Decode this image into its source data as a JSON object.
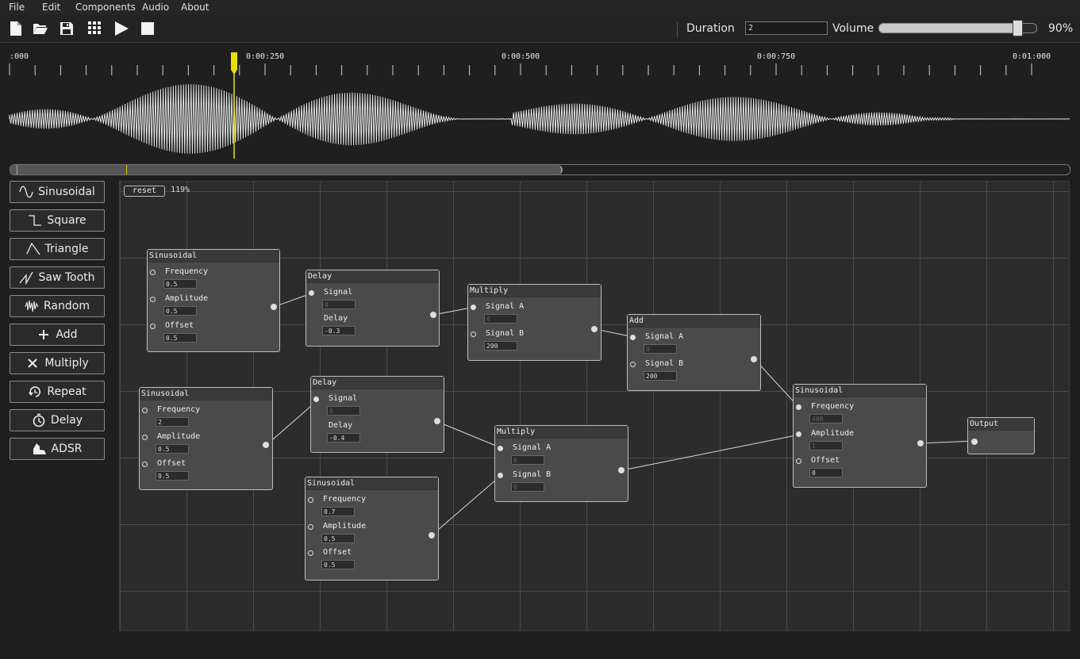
{
  "menu": [
    "File",
    "Edit",
    "Components",
    "Audio",
    "About"
  ],
  "toolbar": {
    "duration_label": "Duration",
    "duration_value": "2",
    "volume_label": "Volume",
    "volume_percent_text": "90%",
    "volume_level": 0.88
  },
  "timeline": {
    "labels": [
      ":000",
      "0:00:250",
      "0:00:500",
      "0:00:750",
      "0:01:000"
    ],
    "scroll_fraction": 0.52
  },
  "sidebar": [
    {
      "label": "Sinusoidal",
      "icon": "sine-icon"
    },
    {
      "label": "Square",
      "icon": "square-wave-icon"
    },
    {
      "label": "Triangle",
      "icon": "triangle-wave-icon"
    },
    {
      "label": "Saw Tooth",
      "icon": "sawtooth-icon"
    },
    {
      "label": "Random",
      "icon": "random-wave-icon"
    },
    {
      "label": "Add",
      "icon": "plus-icon"
    },
    {
      "label": "Multiply",
      "icon": "times-icon"
    },
    {
      "label": "Repeat",
      "icon": "repeat-icon"
    },
    {
      "label": "Delay",
      "icon": "delay-icon"
    },
    {
      "label": "ADSR",
      "icon": "adsr-icon"
    }
  ],
  "canvas": {
    "reset_label": "reset",
    "zoom_text": "119%"
  },
  "nodes": {
    "sin1": {
      "title": "Sinusoidal",
      "p1": "Frequency",
      "v1": "0.5",
      "p2": "Amplitude",
      "v2": "0.5",
      "p3": "Offset",
      "v3": "0.5"
    },
    "sin2": {
      "title": "Sinusoidal",
      "p1": "Frequency",
      "v1": "2",
      "p2": "Amplitude",
      "v2": "0.5",
      "p3": "Offset",
      "v3": "0.5"
    },
    "sin3": {
      "title": "Sinusoidal",
      "p1": "Frequency",
      "v1": "0.7",
      "p2": "Amplitude",
      "v2": "0.5",
      "p3": "Offset",
      "v3": "0.5"
    },
    "delay1": {
      "title": "Delay",
      "p1": "Signal",
      "v1": "0",
      "p2": "Delay",
      "v2": "-0.3"
    },
    "delay2": {
      "title": "Delay",
      "p1": "Signal",
      "v1": "0",
      "p2": "Delay",
      "v2": "-0.4"
    },
    "mul1": {
      "title": "Multiply",
      "p1": "Signal A",
      "v1": "0",
      "p2": "Signal B",
      "v2": "200"
    },
    "mul2": {
      "title": "Multiply",
      "p1": "Signal A",
      "v1": "0",
      "p2": "Signal B",
      "v2": "0"
    },
    "add1": {
      "title": "Add",
      "p1": "Signal A",
      "v1": "0",
      "p2": "Signal B",
      "v2": "200"
    },
    "sin4": {
      "title": "Sinusoidal",
      "p1": "Frequency",
      "v1": "400",
      "p2": "Amplitude",
      "v2": "1",
      "p3": "Offset",
      "v3": "0"
    },
    "output": {
      "title": "Output"
    }
  }
}
